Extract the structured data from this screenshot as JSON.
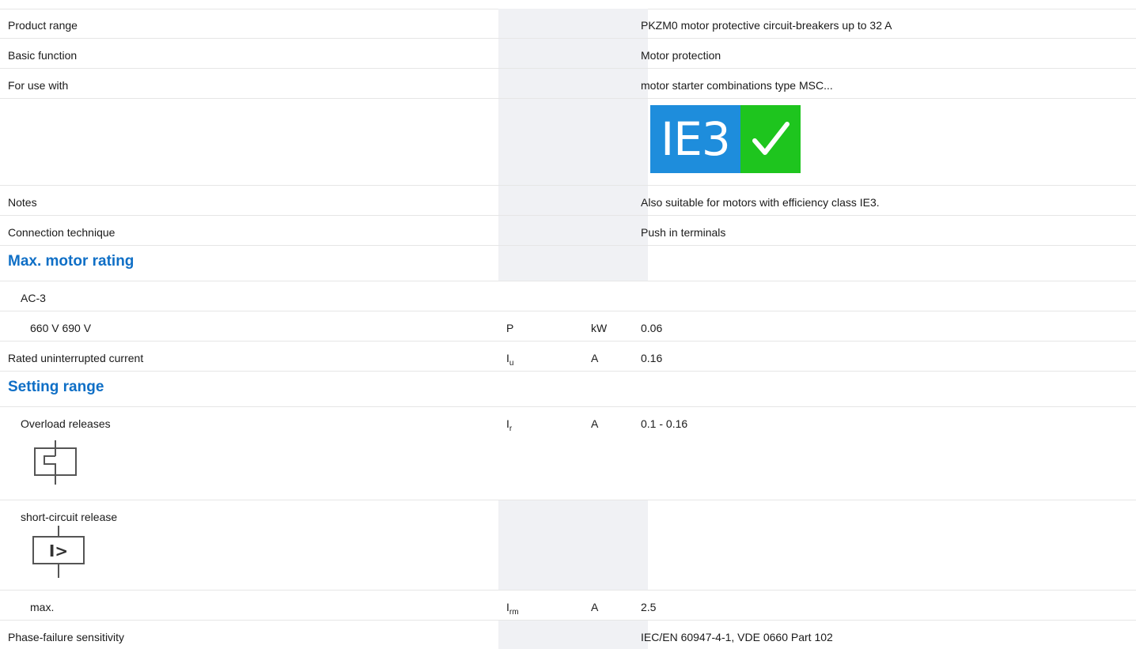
{
  "rows": {
    "product_range": {
      "label": "Product range",
      "value": "PKZM0 motor protective circuit-breakers up to 32 A"
    },
    "basic_function": {
      "label": "Basic function",
      "value": "Motor protection"
    },
    "for_use_with": {
      "label": "For use with",
      "value": "motor starter combinations type MSC..."
    },
    "badge": {
      "text": "IE3",
      "icon": "checkmark-icon",
      "left_color": "#1e8ddc",
      "right_color": "#1ec51e"
    },
    "notes": {
      "label": "Notes",
      "value": "Also suitable for motors with efficiency class IE3."
    },
    "connection": {
      "label": "Connection technique",
      "value": "Push in terminals"
    },
    "max_motor_rating": {
      "title": "Max. motor rating"
    },
    "ac3": {
      "label": "AC-3"
    },
    "v660": {
      "label": "660 V 690 V",
      "symbol": "P",
      "unit": "kW",
      "value": "0.06"
    },
    "rated_current": {
      "label": "Rated uninterrupted current",
      "symbol": "I",
      "symbol_sub": "u",
      "unit": "A",
      "value": "0.16"
    },
    "setting_range": {
      "title": "Setting range"
    },
    "overload": {
      "label": "Overload releases",
      "symbol": "I",
      "symbol_sub": "r",
      "unit": "A",
      "value": "0.1 - 0.16",
      "icon": "thermal-release-icon"
    },
    "short_circuit": {
      "label": "short-circuit release",
      "icon": "magnetic-release-icon",
      "icon_text": "I>"
    },
    "max": {
      "label": "max.",
      "symbol": "I",
      "symbol_sub": "rm",
      "unit": "A",
      "value": "2.5"
    },
    "phase_failure": {
      "label": "Phase-failure sensitivity",
      "value": "IEC/EN 60947-4-1, VDE 0660 Part 102"
    }
  },
  "colors": {
    "accent": "#0f6fc6",
    "shade": "#f0f1f4",
    "divider": "#e6e6e6"
  }
}
